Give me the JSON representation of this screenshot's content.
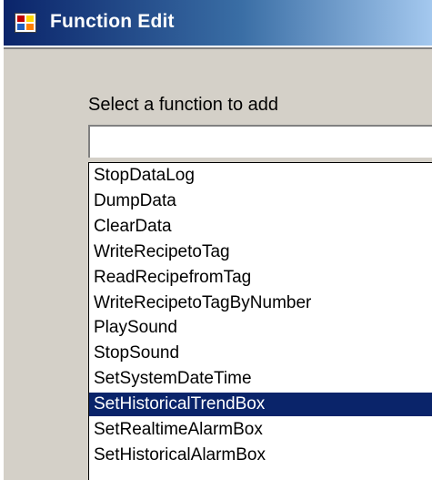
{
  "window": {
    "title": "Function Edit",
    "icon": "app-window-icon"
  },
  "dialog": {
    "prompt": "Select a function to add",
    "combo_value": "",
    "selected_index": 9,
    "colors": {
      "selection_bg": "#0a246a",
      "selection_fg": "#ffffff",
      "face": "#d4d0c8"
    },
    "items": [
      "StopDataLog",
      "DumpData",
      "ClearData",
      "WriteRecipetoTag",
      "ReadRecipefromTag",
      "WriteRecipetoTagByNumber",
      "PlaySound",
      "StopSound",
      "SetSystemDateTime",
      "SetHistoricalTrendBox",
      "SetRealtimeAlarmBox",
      "SetHistoricalAlarmBox"
    ]
  }
}
